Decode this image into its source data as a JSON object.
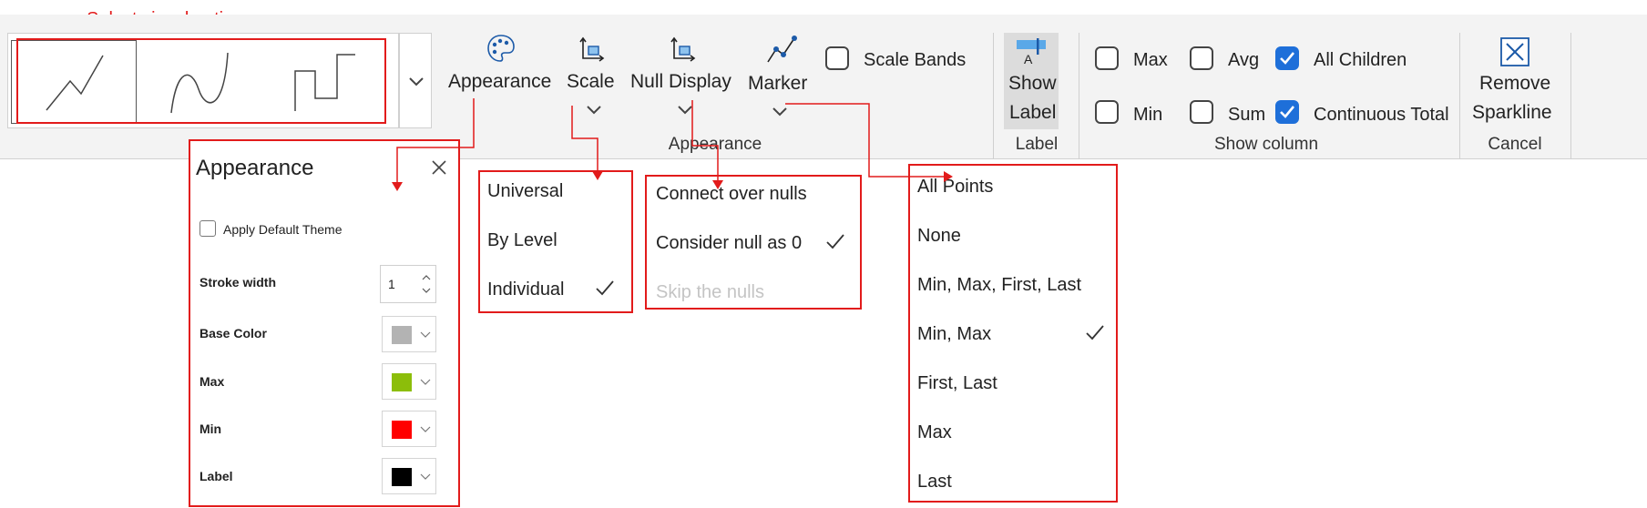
{
  "annotation": {
    "title": "Select visual options"
  },
  "ribbon": {
    "sparkline_types": [
      "line",
      "spline",
      "step"
    ],
    "buttons": {
      "appearance": "Appearance",
      "scale": "Scale",
      "null_display": "Null Display",
      "marker": "Marker",
      "show_label_line1": "Show",
      "show_label_line2": "Label",
      "remove_line1": "Remove",
      "remove_line2": "Sparkline"
    },
    "scale_bands": {
      "label": "Scale Bands",
      "checked": false
    },
    "show_column": [
      {
        "label": "Max",
        "checked": false
      },
      {
        "label": "Avg",
        "checked": false
      },
      {
        "label": "All Children",
        "checked": true
      },
      {
        "label": "Min",
        "checked": false
      },
      {
        "label": "Sum",
        "checked": false
      },
      {
        "label": "Continuous Total",
        "checked": true
      }
    ],
    "groups": {
      "appearance": "Appearance",
      "label": "Label",
      "show_column": "Show column",
      "cancel": "Cancel"
    }
  },
  "appearance_panel": {
    "title": "Appearance",
    "apply_default_theme": {
      "label": "Apply Default Theme",
      "checked": false
    },
    "stroke_width": {
      "label": "Stroke width",
      "value": "1"
    },
    "colors": [
      {
        "label": "Base Color",
        "color": "#b3b3b3"
      },
      {
        "label": "Max",
        "color": "#8cbe0a"
      },
      {
        "label": "Min",
        "color": "#ff0000"
      },
      {
        "label": "Label",
        "color": "#000000"
      }
    ]
  },
  "scale_menu": {
    "items": [
      "Universal",
      "By Level",
      "Individual"
    ],
    "checked": "Individual"
  },
  "null_display_menu": {
    "items": [
      "Connect over nulls",
      "Consider null as 0",
      "Skip the nulls"
    ],
    "checked": "Consider null as 0",
    "disabled": "Skip the nulls"
  },
  "marker_menu": {
    "items": [
      "All Points",
      "None",
      "Min, Max, First, Last",
      "Min, Max",
      "First, Last",
      "Max",
      "Last"
    ],
    "checked": "Min, Max"
  },
  "colors": {
    "annotation": "#e21b1b",
    "accent": "#1e6fd9"
  }
}
